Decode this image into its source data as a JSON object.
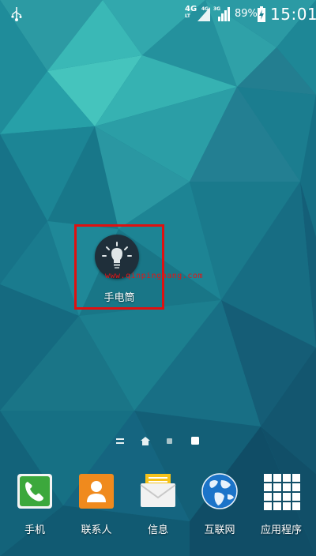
{
  "status_bar": {
    "net_labels": [
      {
        "type": "4G",
        "sub": "LT"
      },
      {
        "type": "4G",
        "sub": ""
      },
      {
        "type": "3G",
        "sub": ""
      }
    ],
    "battery_percent": "89%",
    "time": "15:01",
    "icons": [
      "usb-icon",
      "signal-icon",
      "signal-icon",
      "battery-charging-icon"
    ]
  },
  "home": {
    "flashlight_app": {
      "label": "手电筒",
      "icon": "flashlight-icon",
      "highlight_color": "#e01010"
    },
    "watermark": "www.qinpinghang.com"
  },
  "page_indicator": {
    "items": [
      "menu-lines-icon",
      "home-icon",
      "dot",
      "dot-active"
    ]
  },
  "dock": [
    {
      "label": "手机",
      "icon": "phone-icon",
      "color": "#3ca83c"
    },
    {
      "label": "联系人",
      "icon": "contacts-icon",
      "color": "#f08a1d"
    },
    {
      "label": "信息",
      "icon": "messages-icon",
      "color": "#f5c21b"
    },
    {
      "label": "互联网",
      "icon": "internet-icon",
      "color": "#1c74c9"
    },
    {
      "label": "应用程序",
      "icon": "apps-icon",
      "color": "#ffffff"
    }
  ],
  "colors": {
    "wallpaper_base": "#1a7f90",
    "accent": "#e01010"
  }
}
